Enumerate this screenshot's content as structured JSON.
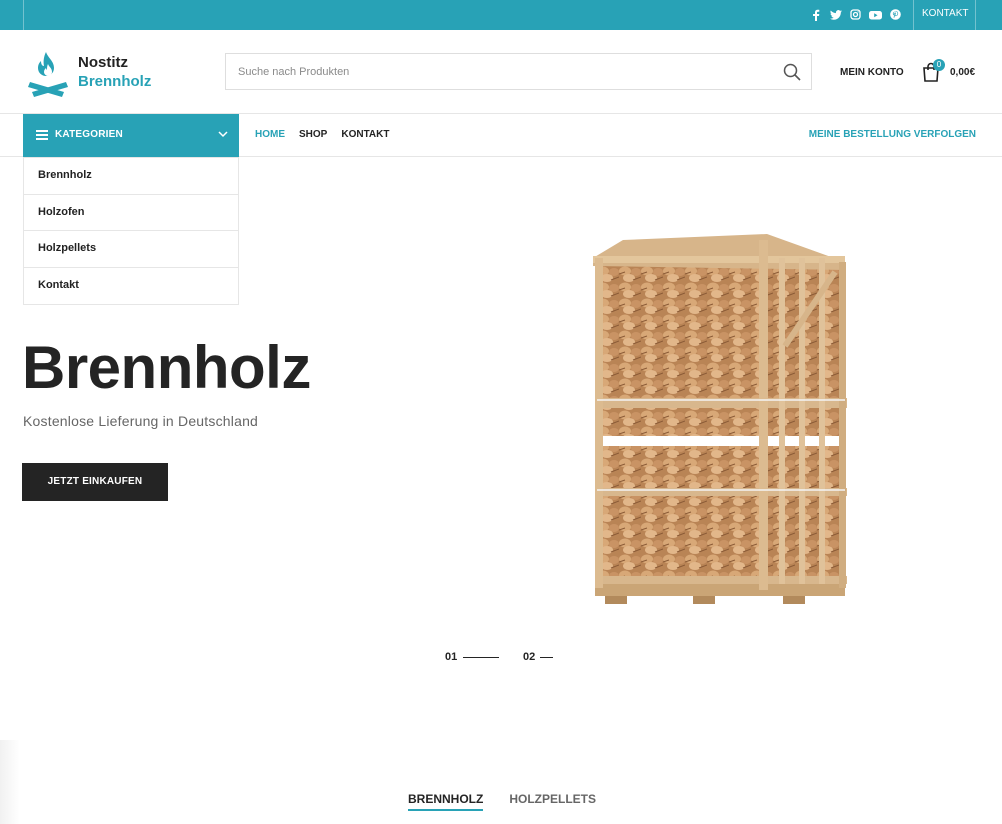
{
  "topbar": {
    "social_icons": [
      "facebook-icon",
      "twitter-icon",
      "instagram-icon",
      "youtube-icon",
      "pinterest-icon"
    ],
    "contact_label": "KONTAKT"
  },
  "brand": {
    "line1": "Nostitz",
    "line2": "Brennholz",
    "accent_color": "#28a2b6"
  },
  "search": {
    "placeholder": "Suche nach Produkten",
    "value": ""
  },
  "account": {
    "label": "MEIN KONTO"
  },
  "cart": {
    "count": "0",
    "total": "0,00€"
  },
  "nav": {
    "categories_label": "KATEGORIEN",
    "links": [
      "HOME",
      "SHOP",
      "KONTAKT"
    ],
    "track_order": "MEINE BESTELLUNG VERFOLGEN"
  },
  "category_menu": [
    "Brennholz",
    "Holzofen",
    "Holzpellets",
    "Kontakt"
  ],
  "hero": {
    "title": "Brennholz",
    "subtitle": "Kostenlose Lieferung in Deutschland",
    "cta": "JETZT EINKAUFEN"
  },
  "slider": {
    "dots": [
      "01",
      "02"
    ],
    "active": "01"
  },
  "product_tabs": [
    "BRENNHOLZ",
    "HOLZPELLETS"
  ]
}
